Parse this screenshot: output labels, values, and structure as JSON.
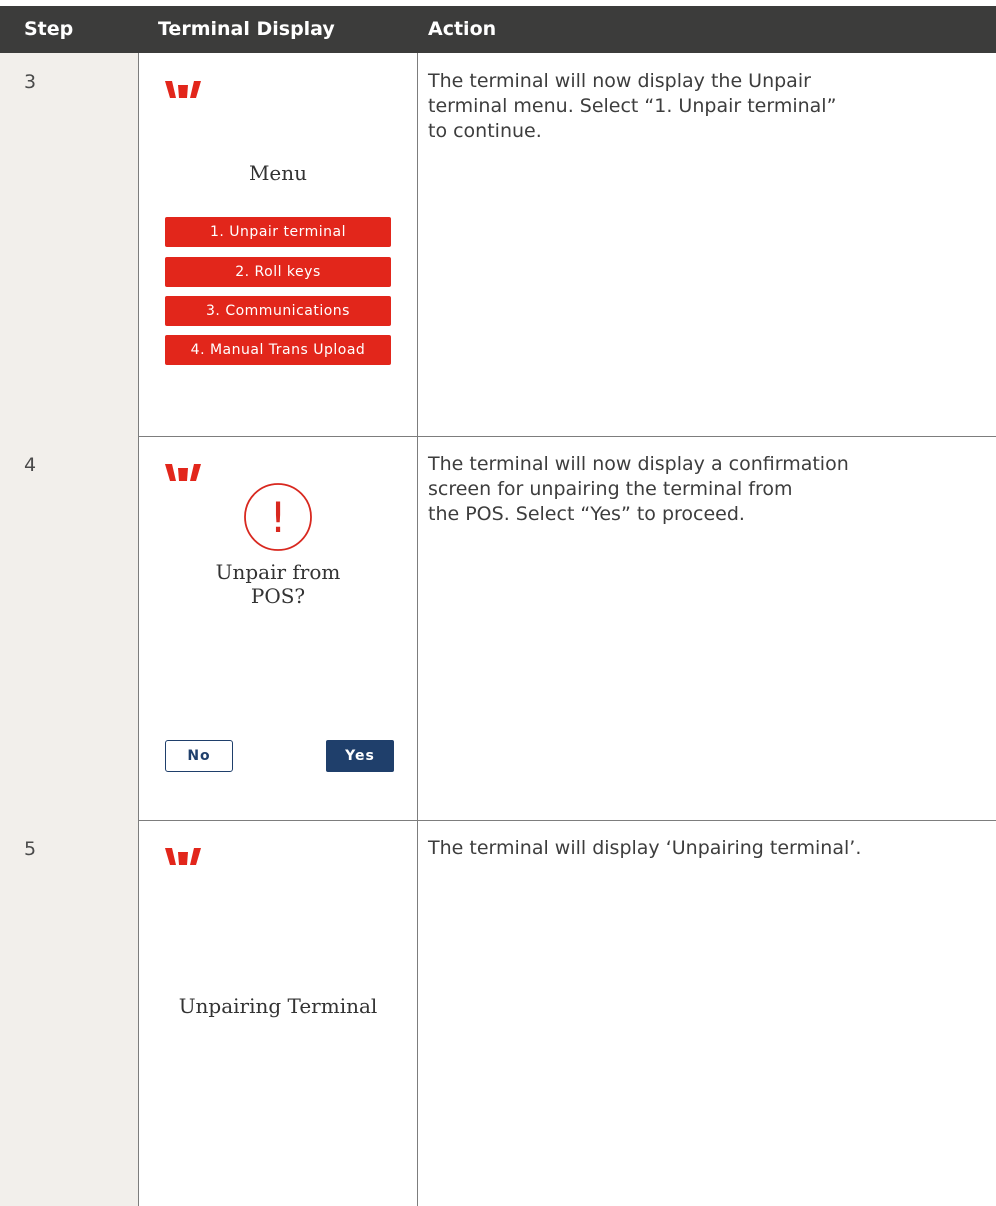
{
  "header": {
    "step": "Step",
    "display": "Terminal Display",
    "action": "Action"
  },
  "rows": [
    {
      "step": "3",
      "screen": {
        "title": "Menu",
        "menu_items": [
          "1. Unpair terminal",
          "2. Roll keys",
          "3. Communications",
          "4. Manual Trans Upload"
        ]
      },
      "action": "The terminal will now display the Unpair\nterminal menu. Select “1. Unpair terminal”\nto continue."
    },
    {
      "step": "4",
      "screen": {
        "icon_symbol": "!",
        "message": "Unpair from\nPOS?",
        "no_label": "No",
        "yes_label": "Yes"
      },
      "action": "The terminal will now display a confirmation\nscreen for unpairing the terminal from\nthe POS. Select “Yes” to proceed."
    },
    {
      "step": "5",
      "screen": {
        "message": "Unpairing Terminal"
      },
      "action": "The terminal will display ‘Unpairing terminal’."
    }
  ],
  "colors": {
    "header_bg": "#3c3c3b",
    "brand_red": "#e2261b",
    "button_navy": "#1f3f6b",
    "step_column_bg": "#f2efeb"
  },
  "icons": [
    "westpac-logo-icon",
    "alert-circle-icon"
  ]
}
